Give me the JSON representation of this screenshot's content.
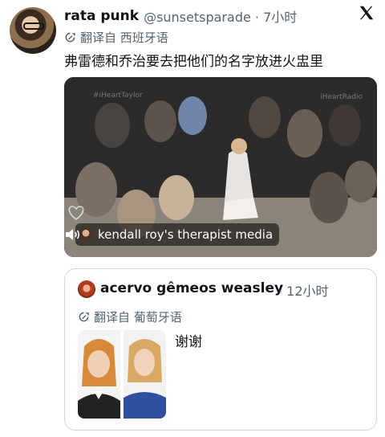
{
  "post": {
    "display_name": "rata punk",
    "handle_and_time": "@sunsetsparade · 7小时",
    "translate_label": "翻译自 西班牙语",
    "text": "弗雷德和乔治要去把他们的名字放进火盅里"
  },
  "video": {
    "caption": "kendall roy's therapist media",
    "watermark_left": "#iHeartTaylor",
    "watermark_right": "iHeartRadio"
  },
  "quote": {
    "display_name": "acervo gêmeos weasley",
    "time": "· 12小时",
    "translate_label": "翻译自 葡萄牙语",
    "text": "谢谢"
  },
  "icons": {
    "platform": "x-logo-icon",
    "translate": "translate-icon",
    "mute": "volume-icon"
  }
}
